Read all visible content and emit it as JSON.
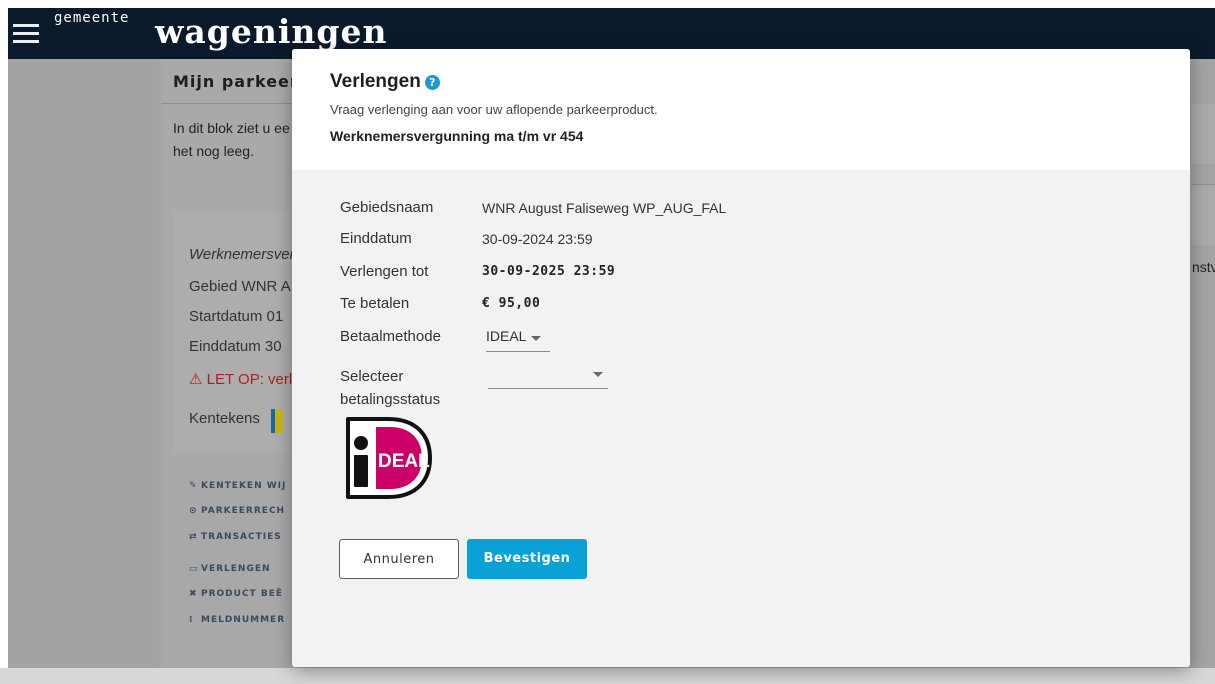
{
  "header": {
    "logo_small": "gemeente",
    "logo_big": "wageningen"
  },
  "background": {
    "section_title": "Mijn parkeer",
    "section_desc_line1": "In dit blok ziet u ee",
    "section_desc_line2": "het nog leeg.",
    "card": {
      "title": "Werknemersver",
      "gebied": "Gebied  WNR A",
      "startdatum": "Startdatum  01",
      "einddatum": "Einddatum  30",
      "warning": "⚠ LET OP: verl",
      "kentekens": "Kentekens"
    },
    "actions": [
      {
        "icon": "pencil-icon",
        "glyph": "✎",
        "label": "KENTEKEN WIJ"
      },
      {
        "icon": "clock-icon",
        "glyph": "⊙",
        "label": "PARKEERRECH"
      },
      {
        "icon": "transfer-icon",
        "glyph": "⇄",
        "label": "TRANSACTIES"
      },
      {
        "icon": "calendar-icon",
        "glyph": "▭",
        "label": "VERLENGEN"
      },
      {
        "icon": "close-icon",
        "glyph": "✖",
        "label": "PRODUCT BEË"
      },
      {
        "icon": "grid-icon",
        "glyph": "⁞",
        "label": "MELDNUMMER"
      }
    ],
    "right_snippet": "nstv"
  },
  "modal": {
    "title": "Verlengen",
    "help_glyph": "?",
    "subtitle": "Vraag verlenging aan voor uw aflopende parkeerproduct.",
    "product": "Werknemersvergunning ma t/m vr 454",
    "rows": {
      "gebiedsnaam_label": "Gebiedsnaam",
      "gebiedsnaam_value": "WNR August Faliseweg WP_AUG_FAL",
      "einddatum_label": "Einddatum",
      "einddatum_value": "30-09-2024 23:59",
      "verlengen_label": "Verlengen tot",
      "verlengen_value": "30-09-2025 23:59",
      "betalen_label": "Te betalen",
      "betalen_value": "€ 95,00",
      "betaalmethode_label": "Betaalmethode",
      "betaalmethode_value": "IDEAL",
      "status_label_line1": "Selecteer",
      "status_label_line2": "betalingsstatus",
      "status_value": ""
    },
    "ideal_logo_text": "DEAL",
    "buttons": {
      "cancel": "Annuleren",
      "confirm": "Bevestigen"
    }
  },
  "colors": {
    "topbar": "#0b1a2b",
    "accent": "#0aa1d6",
    "ideal_pink": "#cc0066"
  }
}
